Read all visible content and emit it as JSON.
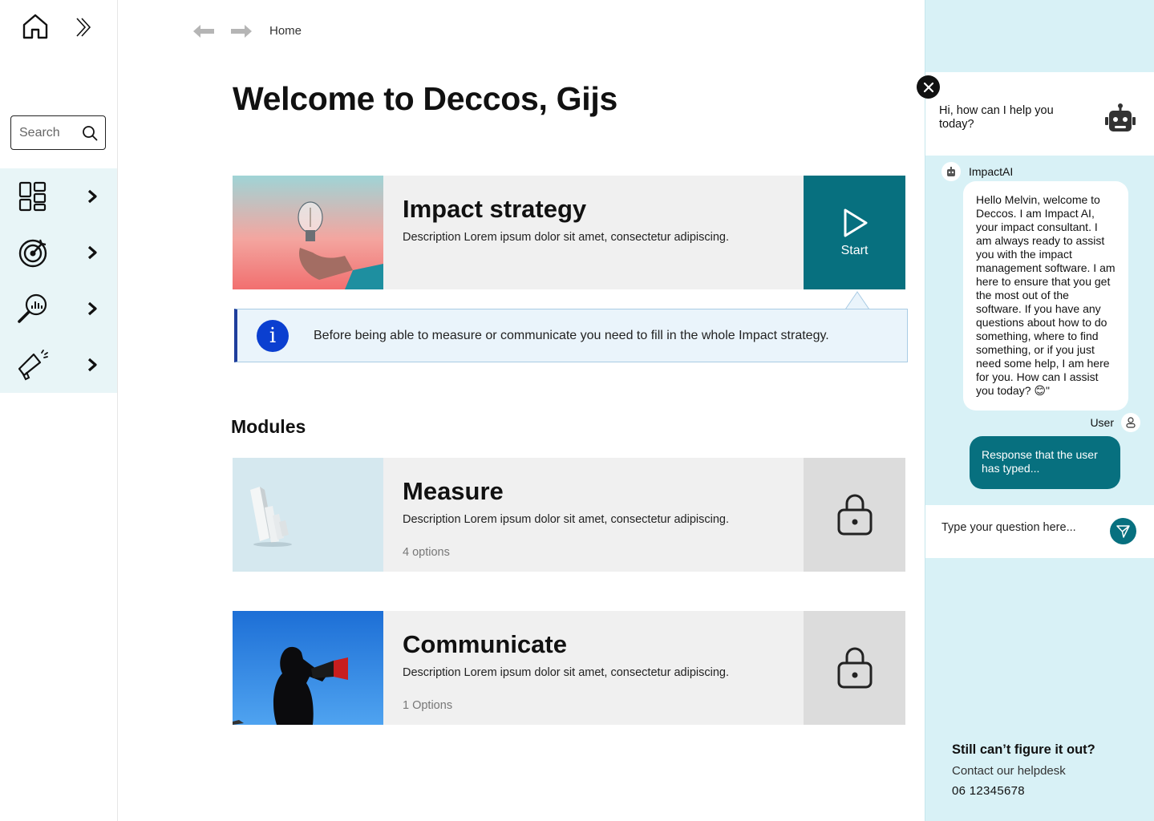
{
  "sidebar": {
    "search_placeholder": "Search",
    "items": [
      {
        "icon": "dashboard-grid-icon"
      },
      {
        "icon": "target-icon"
      },
      {
        "icon": "analytics-search-icon"
      },
      {
        "icon": "megaphone-icon"
      }
    ]
  },
  "header": {
    "breadcrumb": "Home"
  },
  "main": {
    "title": "Welcome to Deccos, Gijs",
    "strategy": {
      "title": "Impact strategy",
      "description": "Description Lorem ipsum dolor sit amet, consectetur adipiscing.",
      "action_label": "Start"
    },
    "info": {
      "text": "Before being able to measure or communicate you need to fill in the whole Impact strategy."
    },
    "modules_heading": "Modules",
    "modules": [
      {
        "title": "Measure",
        "description": "Description Lorem ipsum dolor sit amet, consectetur adipiscing.",
        "options": "4 options"
      },
      {
        "title": "Communicate",
        "description": "Description Lorem ipsum dolor sit amet, consectetur adipiscing.",
        "options": "1 Options"
      }
    ]
  },
  "chat": {
    "greeting": "Hi, how can I help you today?",
    "bot_name": "ImpactAI",
    "bot_message": "Hello Melvin, welcome to Deccos. I am Impact AI, your impact consultant. I am always ready to assist you with the impact management software. I am here to ensure that you get the most out of the software. If you have any questions about how to do something, where to find something, or if you just need some help, I am here for you. How can I assist you today? 😊\"",
    "user_name": "User",
    "user_message": "Response that the user has typed...",
    "input_placeholder": "Type your question here...",
    "help_title": "Still can’t figure it out?",
    "help_subtitle": "Contact our helpdesk",
    "help_phone": "06 12345678"
  },
  "colors": {
    "accent": "#07707f",
    "chat_bg": "#d8f1f6",
    "sidebar_nav_bg": "#e8f5f7",
    "info_icon": "#0b3fd0",
    "card_bg": "#f0f0f0"
  }
}
